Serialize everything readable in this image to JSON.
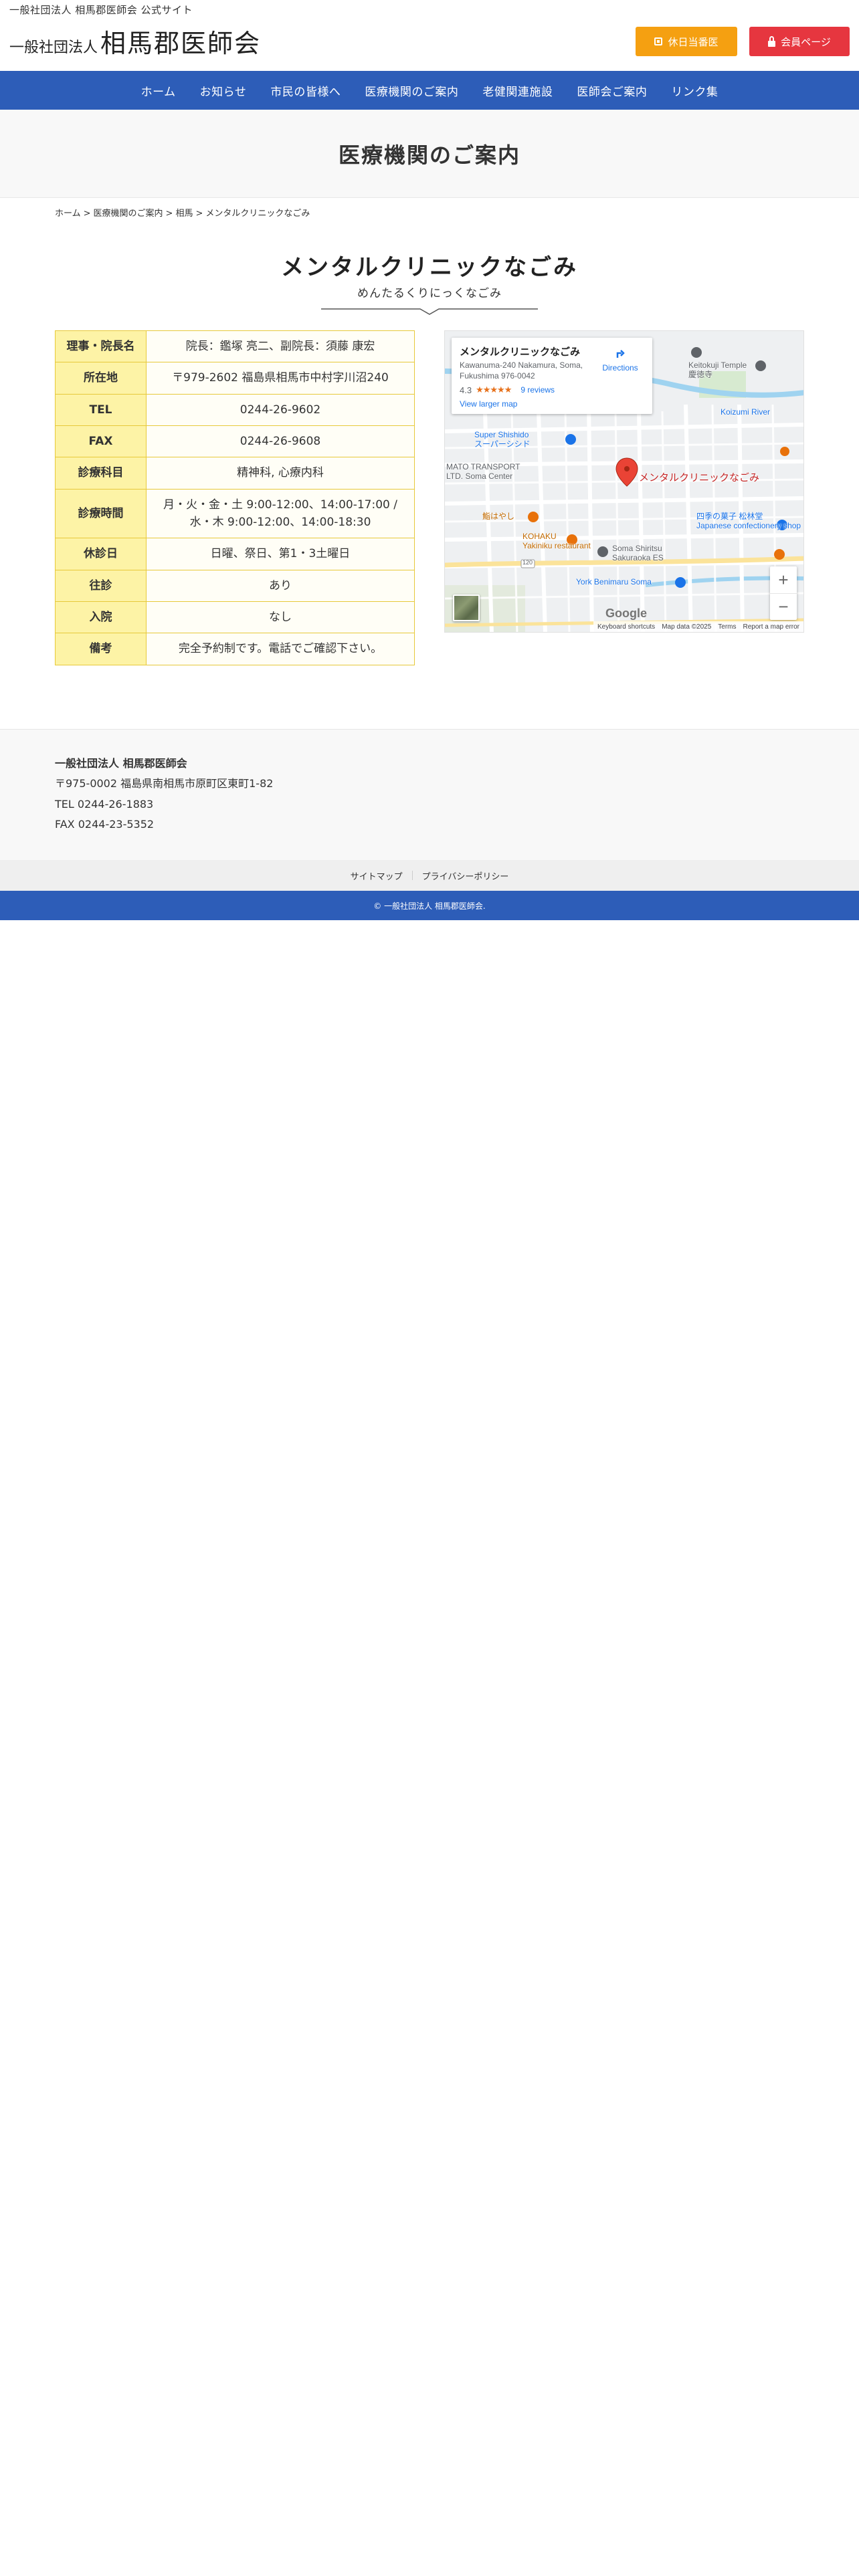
{
  "header": {
    "tagline": "一般社団法人 相馬郡医師会 公式サイト",
    "logo_small": "一般社団法人",
    "logo_big": "相馬郡医師会",
    "holiday_button": "休日当番医",
    "member_button": "会員ページ"
  },
  "nav": {
    "items": [
      "ホーム",
      "お知らせ",
      "市民の皆様へ",
      "医療機関のご案内",
      "老健関連施設",
      "医師会ご案内",
      "リンク集"
    ]
  },
  "page_title": "医療機関のご案内",
  "breadcrumb": {
    "items": [
      "ホーム",
      "医療機関のご案内",
      "相馬",
      "メンタルクリニックなごみ"
    ],
    "separator": ">"
  },
  "clinic": {
    "name": "メンタルクリニックなごみ",
    "kana": "めんたるくりにっくなごみ"
  },
  "info_rows": [
    {
      "label": "理事・院長名",
      "value": "院長：鑑塚 亮二、副院長：須藤 康宏"
    },
    {
      "label": "所在地",
      "value": "〒979-2602 福島県相馬市中村字川沼240"
    },
    {
      "label": "TEL",
      "value": "0244-26-9602"
    },
    {
      "label": "FAX",
      "value": "0244-26-9608"
    },
    {
      "label": "診療科目",
      "value": "精神科, 心療内科"
    },
    {
      "label": "診療時間",
      "value": "月・火・金・土 9:00-12:00、14:00-17:00 / 水・木 9:00-12:00、14:00-18:30"
    },
    {
      "label": "休診日",
      "value": "日曜、祭日、第1・3土曜日"
    },
    {
      "label": "往診",
      "value": "あり"
    },
    {
      "label": "入院",
      "value": "なし"
    },
    {
      "label": "備考",
      "value": "完全予約制です。電話でご確認下さい。"
    }
  ],
  "map": {
    "card_name": "メンタルクリニックなごみ",
    "card_address": "Kawanuma-240 Nakamura, Soma, Fukushima 976-0042",
    "rating": "4.3",
    "stars": "★★★★★",
    "reviews": "9 reviews",
    "larger_map": "View larger map",
    "directions": "Directions",
    "pin_label": "メンタルクリニックなごみ",
    "labels": {
      "ketokuji": "Keitokuji Temple",
      "ketokuji_jp": "慶徳寺",
      "super_shishido": "Super Shishido",
      "super_shishido_jp": "スーパーシシド",
      "mato": "MATO TRANSPORT",
      "mato2": "LTD. Soma Center",
      "kohaku": "KOHAKU",
      "yakiniku": "Yakiniku restaurant",
      "restaurant": "鮨はやし",
      "sakuraoka": "Soma Shiritsu",
      "sakuraoka2": "Sakuraoka ES",
      "york": "York Benimaru Soma",
      "shiki": "四季の菓子 松林堂",
      "confectionery": "Japanese confectionery shop",
      "koizumi": "Koizumi River",
      "road": "120"
    },
    "google": "Google",
    "attribution": [
      "Keyboard shortcuts",
      "Map data ©2025",
      "Terms",
      "Report a map error"
    ]
  },
  "footer": {
    "org": "一般社団法人 相馬郡医師会",
    "address": "〒975-0002 福島県南相馬市原町区東町1-82",
    "tel": "TEL 0244-26-1883",
    "fax": "FAX 0244-23-5352",
    "links": [
      "サイトマップ",
      "プライバシーポリシー"
    ],
    "copyright": "© 一般社団法人 相馬郡医師会."
  },
  "colors": {
    "nav": "#2d5db8",
    "holiday": "#f5a011",
    "member": "#e6363f",
    "table_header": "#fdf3a6",
    "table_border": "#e7c93a"
  }
}
